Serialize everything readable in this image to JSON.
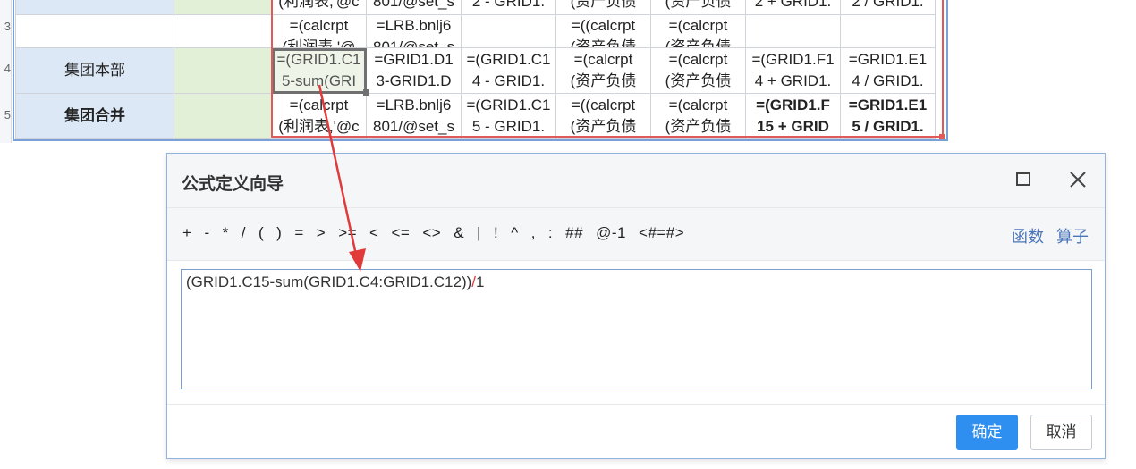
{
  "grid": {
    "row_headers": [
      "3",
      "4",
      "5"
    ],
    "rows": [
      {
        "name": "",
        "cells": [
          "(利润表,'@c",
          "801/@set_s",
          "2 - GRID1.",
          "(资产负债",
          "(资产负债",
          "2 + GRID1.",
          "2 / GRID1."
        ]
      },
      {
        "name": "",
        "cells": [
          "=(calcrpt\n(利润表,'@",
          "=LRB.bnlj6\n801/@set_s",
          "",
          "=((calcrpt\n(资产负债",
          "=(calcrpt\n(资产负债",
          "",
          ""
        ]
      },
      {
        "name": "集团本部",
        "cells": [
          "=(GRID1.C1\n5-sum(GRI",
          "=GRID1.D1\n3-GRID1.D",
          "=(GRID1.C1\n4 - GRID1.",
          "=(calcrpt\n(资产负债",
          "=(calcrpt\n(资产负债",
          "=(GRID1.F1\n4 + GRID1.",
          "=GRID1.E1\n4 / GRID1."
        ]
      },
      {
        "name": "集团合并",
        "cells": [
          "=(calcrpt\n(利润表,'@c",
          "=LRB.bnlj6\n801/@set_s",
          "=(GRID1.C1\n5 - GRID1.",
          "=((calcrpt\n(资产负债",
          "=(calcrpt\n(资产负债",
          "=(GRID1.F\n15 + GRID",
          "=GRID1.E1\n5 / GRID1."
        ]
      }
    ]
  },
  "dialog": {
    "title": "公式定义向导",
    "operators": [
      "+",
      "-",
      "*",
      "/",
      "(",
      ")",
      "=",
      ">",
      ">=",
      "<",
      "<=",
      "<>",
      "&",
      "|",
      "!",
      "^",
      ",",
      ":",
      "##",
      "@-1",
      "<#=#>"
    ],
    "links": {
      "functions": "函数",
      "operators_link": "算子"
    },
    "formula": {
      "before": "(GRID1.C15-sum(GRID1.C4:GRID1.C12))",
      "highlight": "/",
      "after": "1"
    },
    "ok_label": "确定",
    "cancel_label": "取消"
  },
  "colors": {
    "accent": "#2f8ff0",
    "arrow": "#e03a3a",
    "link": "#4a76b8",
    "name_cell": "#dce8f6",
    "green_cell": "#e3f0d8"
  }
}
